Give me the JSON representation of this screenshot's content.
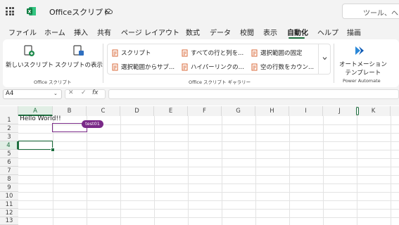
{
  "app": {
    "doc_title": "Officeスクリプト",
    "search_placeholder": "ツール、ヘル"
  },
  "menu": {
    "tabs": [
      "ファイル",
      "ホーム",
      "挿入",
      "共有",
      "ページ レイアウト",
      "数式",
      "データ",
      "校閲",
      "表示",
      "自動化",
      "ヘルプ",
      "描画"
    ],
    "active_tab": "自動化"
  },
  "ribbon": {
    "office_scripts_group": {
      "label": "Office スクリプト",
      "new_script": "新しいスクリプト",
      "show_scripts": "スクリプトの表示"
    },
    "gallery_group": {
      "label": "Office スクリプト ギャラリー",
      "items": [
        "スクリプト",
        "すべての行と列を...",
        "選択範囲の固定",
        "選択範囲からサブ...",
        "ハイパーリンクの...",
        "空の行数をカウン..."
      ]
    },
    "power_automate_group": {
      "label": "Power Automate",
      "automate_templates_line1": "オートメーション",
      "automate_templates_line2": "テンプレート"
    }
  },
  "formula_bar": {
    "name_box": "A4",
    "cancel_symbol": "✕",
    "enter_symbol": "✓",
    "fx_symbol": "fx",
    "formula_value": ""
  },
  "sheet": {
    "columns": [
      "A",
      "B",
      "C",
      "D",
      "E",
      "F",
      "G",
      "H",
      "I",
      "J",
      "K"
    ],
    "rows": [
      "1",
      "2",
      "3",
      "4",
      "5",
      "6",
      "7",
      "8",
      "9",
      "10",
      "11",
      "12",
      "13"
    ],
    "cells": {
      "A1": "Hello World!!"
    },
    "active_cell": "A4",
    "collaborator_cell": "B2",
    "collaborator_name": "test01"
  },
  "colors": {
    "accent": "#1e6f3f",
    "collaborator": "#7a2a88",
    "script_icon": "#d86a3a"
  }
}
